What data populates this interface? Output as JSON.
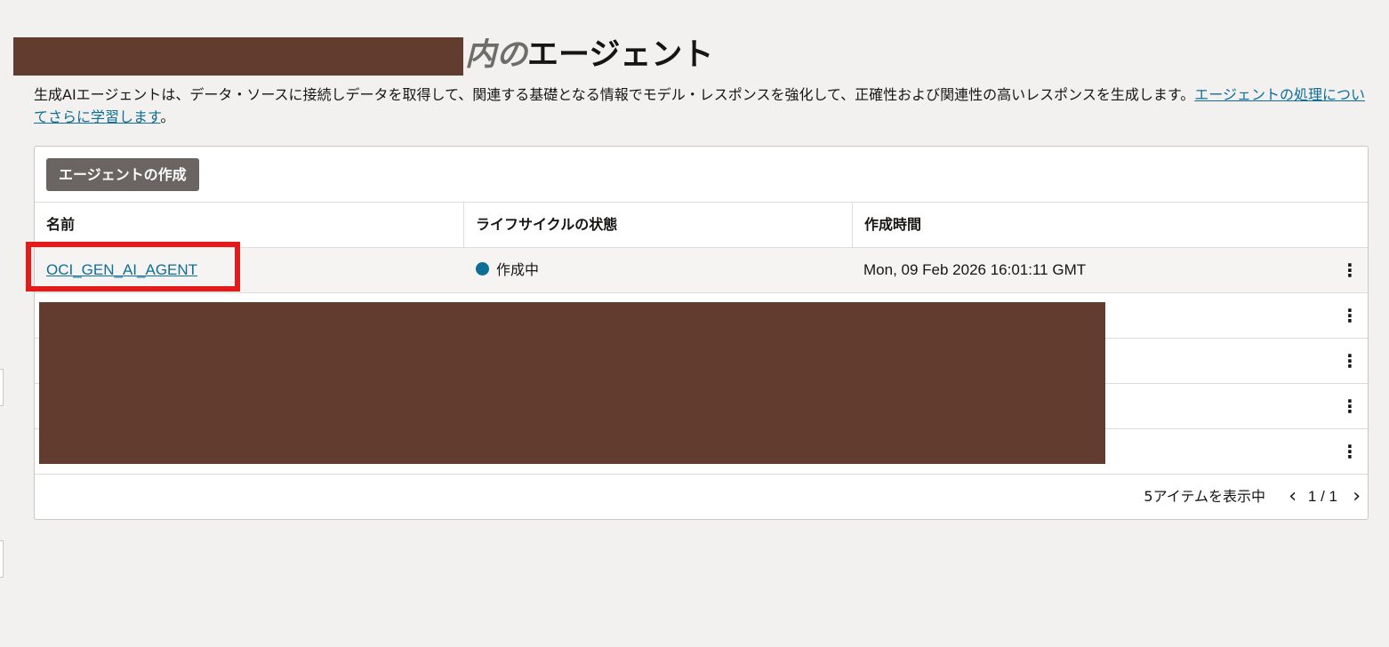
{
  "heading": {
    "italic": "内の",
    "rest": "エージェント"
  },
  "description": {
    "text": "生成AIエージェントは、データ・ソースに接続しデータを取得して、関連する基礎となる情報でモデル・レスポンスを強化して、正確性および関連性の高いレスポンスを生成します。",
    "link": "エージェントの処理についてさらに学習します",
    "suffix": "。"
  },
  "toolbar": {
    "create_label": "エージェントの作成"
  },
  "table": {
    "headers": [
      "名前",
      "ライフサイクルの状態",
      "作成時間"
    ],
    "rows": [
      {
        "name": "OCI_GEN_AI_AGENT",
        "state": "作成中",
        "created": "Mon, 09 Feb 2026 16:01:11 GMT"
      }
    ],
    "actions_icon": "⋮"
  },
  "pagination": {
    "count_label": "5アイテムを表示中",
    "page": "1 / 1",
    "prev_icon": "chevron-left-icon",
    "next_icon": "chevron-right-icon"
  },
  "colors": {
    "accent": "#0e6e96",
    "button": "#6a6562",
    "highlight": "#e41b1b",
    "redaction": "#633c30"
  }
}
